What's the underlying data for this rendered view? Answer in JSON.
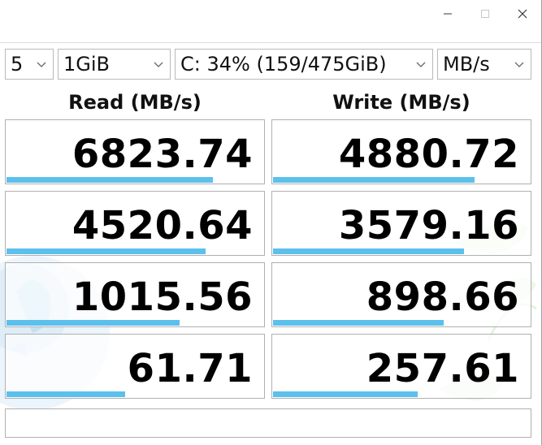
{
  "window": {
    "minimize_label": "Minimize",
    "maximize_label": "Maximize",
    "close_label": "Close"
  },
  "controls": {
    "count": "5",
    "size": "1GiB",
    "drive": "C: 34% (159/475GiB)",
    "unit": "MB/s"
  },
  "headers": {
    "read": "Read (MB/s)",
    "write": "Write (MB/s)"
  },
  "results": [
    {
      "read": "6823.74",
      "write": "4880.72",
      "read_fill": 0.8,
      "write_fill": 0.78
    },
    {
      "read": "4520.64",
      "write": "3579.16",
      "read_fill": 0.77,
      "write_fill": 0.74
    },
    {
      "read": "1015.56",
      "write": "898.66",
      "read_fill": 0.67,
      "write_fill": 0.66
    },
    {
      "read": "61.71",
      "write": "257.61",
      "read_fill": 0.46,
      "write_fill": 0.56
    }
  ],
  "status": "",
  "colors": {
    "bar": "#5cc0ec",
    "border": "#b0b0b0"
  }
}
